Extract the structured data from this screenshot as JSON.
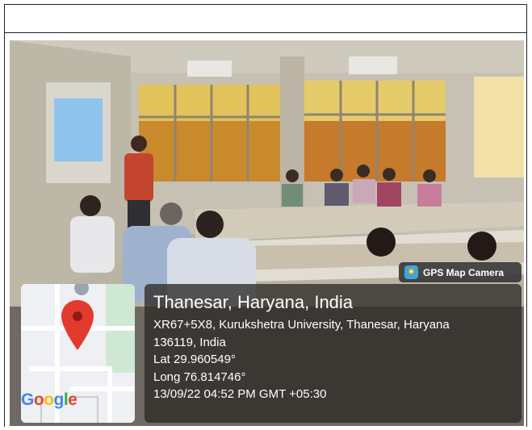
{
  "badge": {
    "label": "GPS Map Camera",
    "icon": "gps-camera-icon"
  },
  "map": {
    "logo": {
      "g1": "G",
      "o1": "o",
      "o2": "o",
      "g2": "g",
      "l": "l",
      "e": "e"
    },
    "pin_icon": "map-pin-icon"
  },
  "location": {
    "title": "Thanesar, Haryana, India",
    "address_line1": "XR67+5X8, Kurukshetra University, Thanesar, Haryana",
    "address_line2": "136119, India",
    "lat": "Lat 29.960549°",
    "long": "Long 76.814746°",
    "timestamp": "13/09/22 04:52 PM GMT +05:30"
  },
  "colors": {
    "pin": "#e23b2e",
    "overlay": "#2d2a26",
    "badge": "#323232"
  }
}
